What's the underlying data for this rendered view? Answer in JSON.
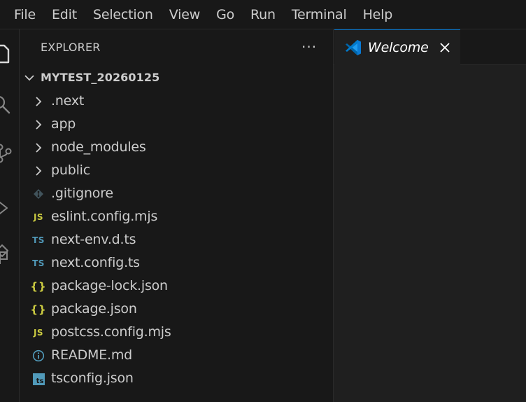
{
  "menu": {
    "items": [
      {
        "label": "File"
      },
      {
        "label": "Edit"
      },
      {
        "label": "Selection"
      },
      {
        "label": "View"
      },
      {
        "label": "Go"
      },
      {
        "label": "Run"
      },
      {
        "label": "Terminal"
      },
      {
        "label": "Help"
      }
    ]
  },
  "activity_bar": {
    "icons": [
      "explorer-icon",
      "search-icon",
      "source-control-icon",
      "run-debug-icon",
      "extensions-icon"
    ]
  },
  "explorer": {
    "title": "EXPLORER",
    "more_label": "···",
    "root": {
      "label": "MYTEST_20260125"
    },
    "items": [
      {
        "label": ".next",
        "kind": "folder"
      },
      {
        "label": "app",
        "kind": "folder"
      },
      {
        "label": "node_modules",
        "kind": "folder"
      },
      {
        "label": "public",
        "kind": "folder"
      },
      {
        "label": ".gitignore",
        "kind": "git"
      },
      {
        "label": "eslint.config.mjs",
        "kind": "js",
        "badge": "JS"
      },
      {
        "label": "next-env.d.ts",
        "kind": "ts",
        "badge": "TS"
      },
      {
        "label": "next.config.ts",
        "kind": "ts",
        "badge": "TS"
      },
      {
        "label": "package-lock.json",
        "kind": "json",
        "badge": "{}"
      },
      {
        "label": "package.json",
        "kind": "json",
        "badge": "{}"
      },
      {
        "label": "postcss.config.mjs",
        "kind": "js",
        "badge": "JS"
      },
      {
        "label": "README.md",
        "kind": "info"
      },
      {
        "label": "tsconfig.json",
        "kind": "tsconfig",
        "badge": "ts"
      }
    ]
  },
  "editor": {
    "tabs": [
      {
        "label": "Welcome",
        "active": true
      }
    ]
  },
  "colors": {
    "background": "#181818",
    "editor_background": "#1f1f1f",
    "accent": "#0078d4",
    "js_yellow": "#cbcb41",
    "ts_blue": "#519aba",
    "vscode_blue": "#0a7ad4"
  }
}
